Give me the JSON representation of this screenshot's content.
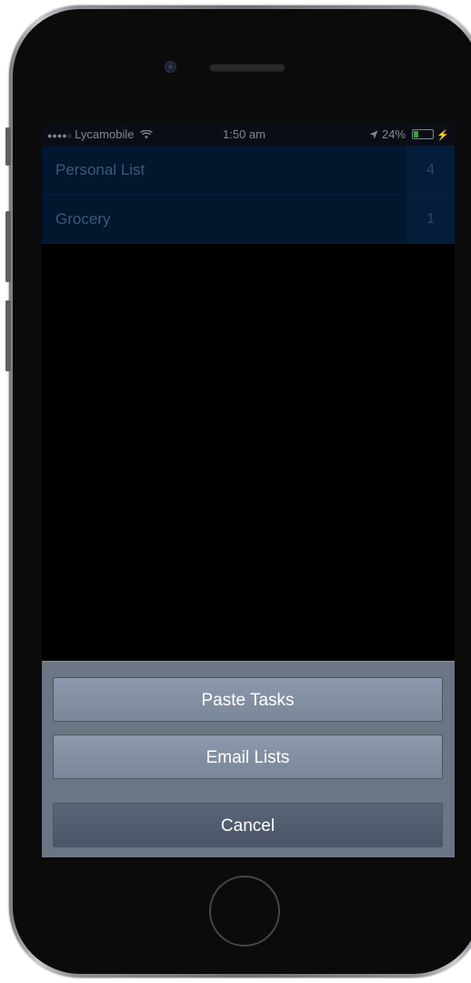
{
  "status_bar": {
    "carrier": "Lycamobile",
    "time": "1:50 am",
    "battery": "24%",
    "battery_level": 0.24
  },
  "lists": [
    {
      "name": "Personal List",
      "count": "4"
    },
    {
      "name": "Grocery",
      "count": "1"
    }
  ],
  "action_sheet": {
    "paste_label": "Paste Tasks",
    "email_label": "Email Lists",
    "cancel_label": "Cancel"
  },
  "colors": {
    "list_background": "#02162d",
    "sheet_background": "#6c7583",
    "battery_fill": "#35a53a"
  }
}
